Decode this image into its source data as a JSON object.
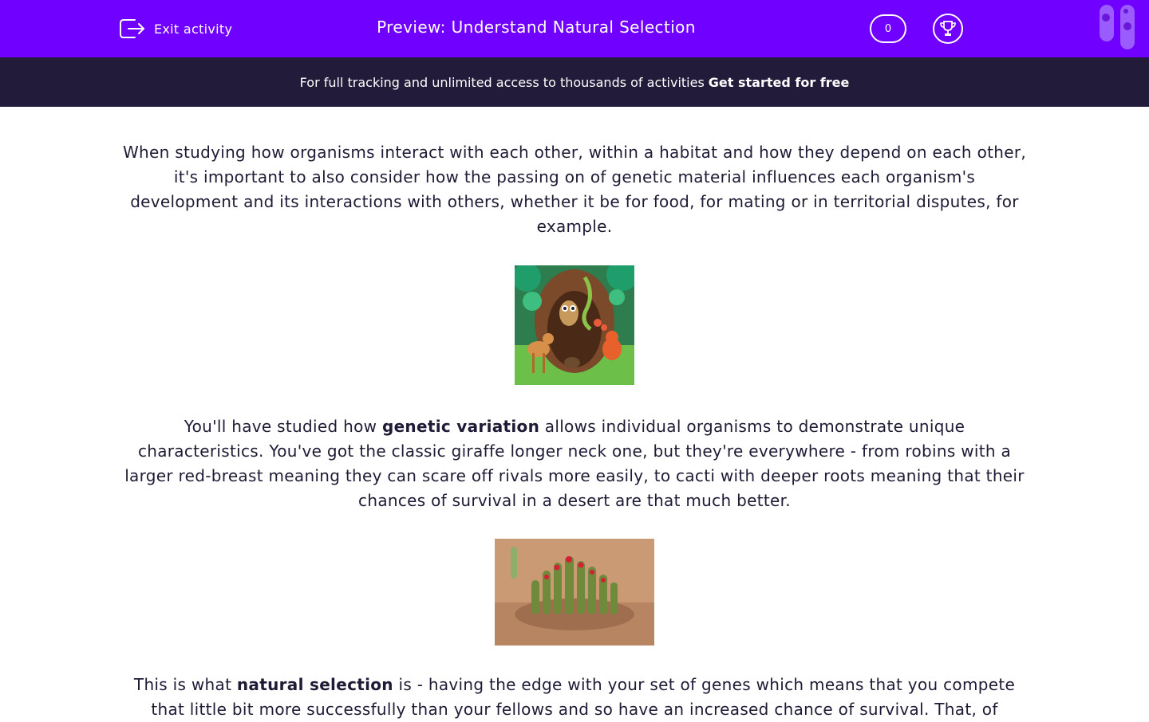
{
  "header": {
    "exit_label": "Exit activity",
    "title": "Preview: Understand Natural Selection",
    "score": "0",
    "accent_color": "#7000ff"
  },
  "promo": {
    "text": "For full tracking and unlimited access to thousands of activities",
    "cta": "Get started for free",
    "bg_color": "#231b3a"
  },
  "content": {
    "p1": "When studying how organisms interact with each other, within a habitat and how they depend on each other, it's important to also consider how the passing on of genetic material influences each organism's development and its interactions with others, whether it be for food, for mating or in territorial disputes, for example.",
    "image1": "forest animals illustration",
    "p2_before": "You'll have studied how ",
    "p2_bold": "genetic variation",
    "p2_after": " allows individual organisms to demonstrate unique characteristics. You've got the classic giraffe longer neck one, but they're everywhere - from robins with a larger red-breast meaning they can scare off rivals more easily, to cacti with deeper roots meaning that their chances of survival in a desert are that much better.",
    "image2": "cactus in desert photo",
    "p3_before": "This is what ",
    "p3_bold": "natural selection",
    "p3_after": " is - having the edge with your set of genes which means that you compete that little bit more successfully than your fellows and so have an increased chance of survival. That, of"
  },
  "icons": {
    "exit": "exit-icon",
    "trophy": "trophy-icon",
    "logo": "test-tubes-logo"
  }
}
